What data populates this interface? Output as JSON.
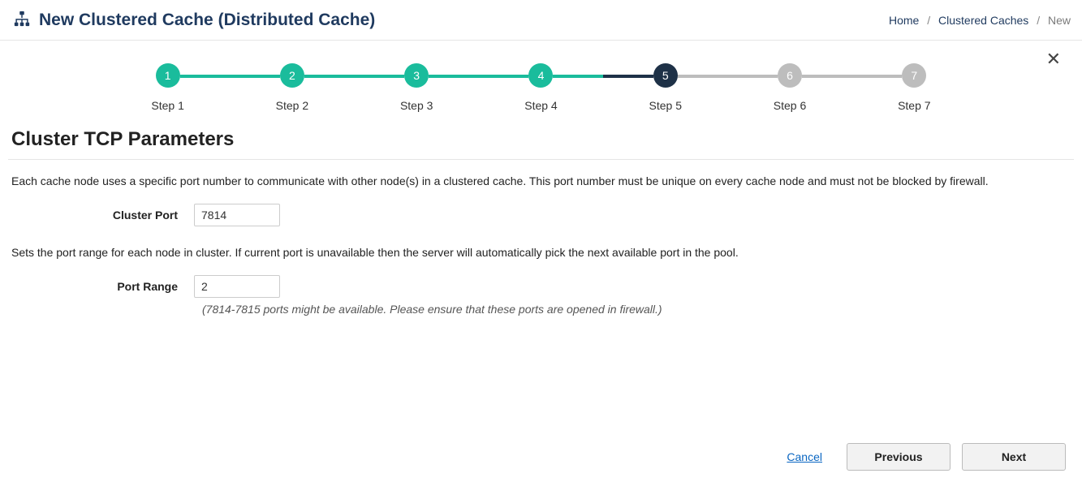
{
  "header": {
    "title": "New Clustered Cache (Distributed Cache)",
    "breadcrumb": {
      "home": "Home",
      "caches": "Clustered Caches",
      "new": "New"
    }
  },
  "stepper": [
    {
      "num": "1",
      "label": "Step 1",
      "state": "done",
      "line": "done"
    },
    {
      "num": "2",
      "label": "Step 2",
      "state": "done",
      "line": "done"
    },
    {
      "num": "3",
      "label": "Step 3",
      "state": "done",
      "line": "done"
    },
    {
      "num": "4",
      "label": "Step 4",
      "state": "done",
      "line": "half"
    },
    {
      "num": "5",
      "label": "Step 5",
      "state": "current",
      "line": "future"
    },
    {
      "num": "6",
      "label": "Step 6",
      "state": "future",
      "line": "future"
    },
    {
      "num": "7",
      "label": "Step 7",
      "state": "future",
      "line": ""
    }
  ],
  "section": {
    "title": "Cluster TCP Parameters",
    "help1": "Each cache node uses a specific port number to communicate with other node(s) in a clustered cache. This port number must be unique on every cache node and must not be blocked by firewall.",
    "clusterPort": {
      "label": "Cluster Port",
      "value": "7814"
    },
    "help2": "Sets the port range for each node in cluster. If current port is unavailable then the server will automatically pick the next available port in the pool.",
    "portRange": {
      "label": "Port Range",
      "value": "2"
    },
    "note": "(7814-7815 ports might be available. Please ensure that these ports are opened in firewall.)"
  },
  "footer": {
    "cancel": "Cancel",
    "previous": "Previous",
    "next": "Next"
  }
}
